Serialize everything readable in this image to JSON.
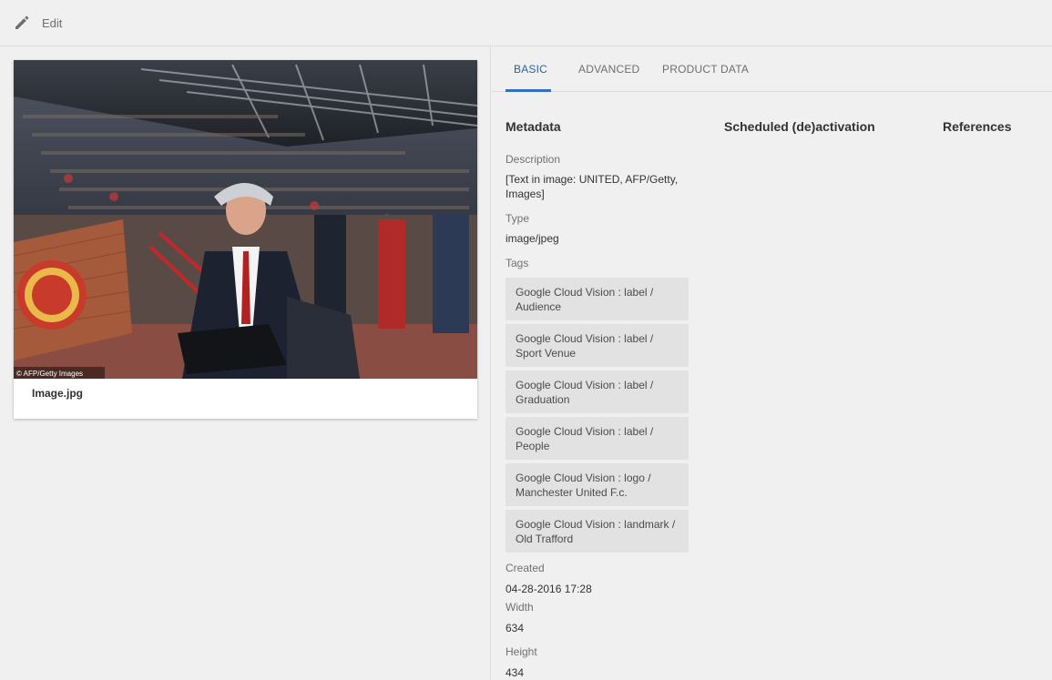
{
  "toolbar": {
    "edit_label": "Edit",
    "edit_icon": "pencil-icon"
  },
  "asset": {
    "filename": "Image.jpg",
    "credit": "© AFP/Getty Images"
  },
  "tabs": [
    {
      "label": "BASIC",
      "active": true
    },
    {
      "label": "ADVANCED",
      "active": false
    },
    {
      "label": "PRODUCT DATA",
      "active": false
    }
  ],
  "sections": {
    "metadata": "Metadata",
    "scheduled": "Scheduled (de)activation",
    "references": "References"
  },
  "metadata": {
    "description_label": "Description",
    "description_value": "[Text in image: UNITED, AFP/Getty, Images]",
    "type_label": "Type",
    "type_value": "image/jpeg",
    "tags_label": "Tags",
    "tags": [
      "Google Cloud Vision : label / Audience",
      "Google Cloud Vision : label / Sport Venue",
      "Google Cloud Vision : label / Graduation",
      "Google Cloud Vision : label / People",
      "Google Cloud Vision : logo / Manchester United F.c.",
      "Google Cloud Vision : landmark / Old Trafford"
    ],
    "created_label": "Created",
    "created_value": "04-28-2016 17:28",
    "width_label": "Width",
    "width_value": "634",
    "height_label": "Height",
    "height_value": "434"
  },
  "colors": {
    "accent": "#326ec8",
    "tag_bg": "#e2e2e2",
    "background": "#f0f0f0"
  }
}
